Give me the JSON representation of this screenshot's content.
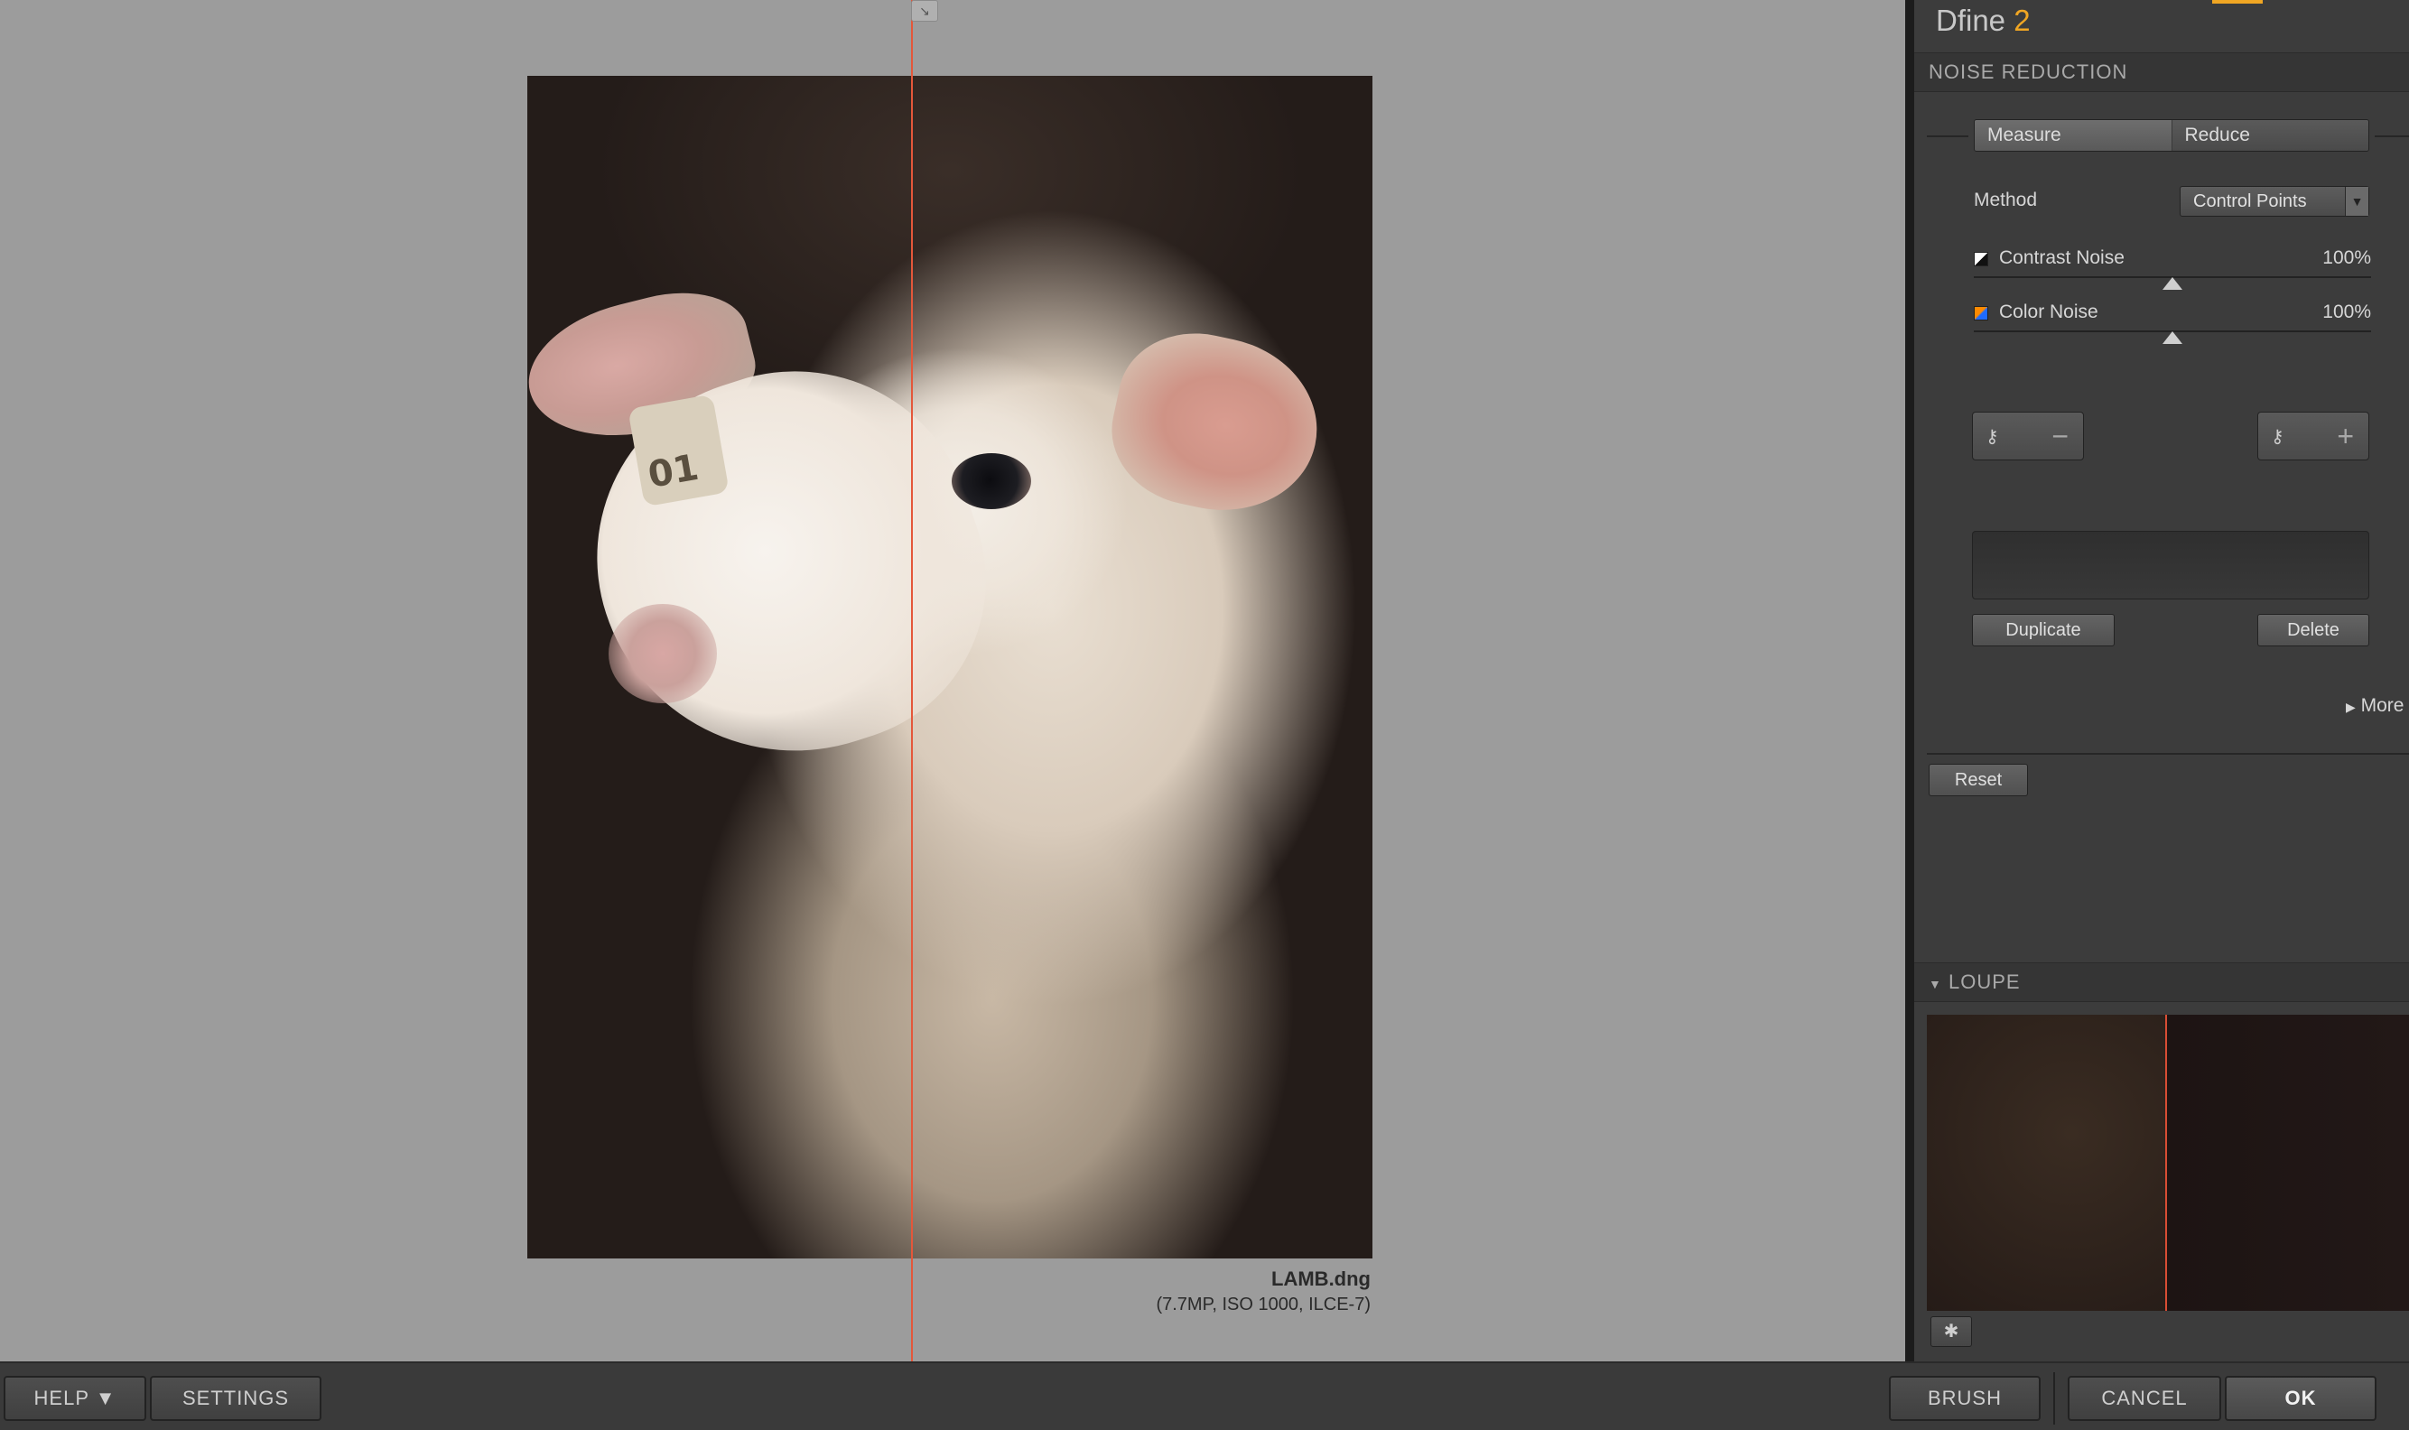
{
  "app": {
    "name": "Dfine",
    "version": "2"
  },
  "canvas": {
    "photo": {
      "ear_tag_text": "01",
      "alt": "lamb portrait"
    },
    "file_name": "LAMB.dng",
    "file_info": "(7.7MP, ISO 1000, ILCE-7)"
  },
  "noise_reduction": {
    "header": "NOISE REDUCTION",
    "tabs": [
      {
        "label": "Measure",
        "active": true
      },
      {
        "label": "Reduce",
        "active": false
      }
    ],
    "method": {
      "label": "Method",
      "value": "Control Points"
    },
    "sliders": [
      {
        "label": "Contrast Noise",
        "value": "100%",
        "fraction": 0.5
      },
      {
        "label": "Color Noise",
        "value": "100%",
        "fraction": 0.5
      }
    ],
    "duplicate_label": "Duplicate",
    "delete_label": "Delete",
    "more_label": "More",
    "reset_label": "Reset"
  },
  "loupe": {
    "header": "LOUPE"
  },
  "bottom": {
    "help_label": "HELP ▼",
    "settings_label": "SETTINGS",
    "brush_label": "BRUSH",
    "cancel_label": "CANCEL",
    "ok_label": "OK"
  },
  "colors": {
    "accent": "#f0a623",
    "split_line": "#e4573a"
  }
}
